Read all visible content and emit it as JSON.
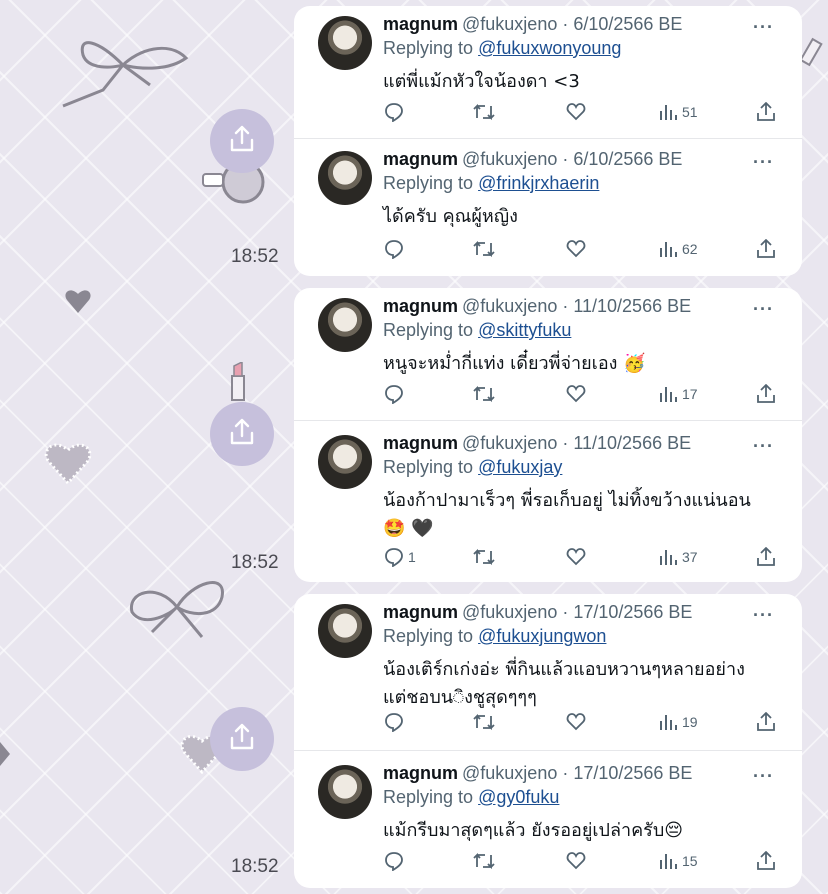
{
  "timestamps": [
    "18:52",
    "18:52",
    "18:52"
  ],
  "icons": {
    "share": "share-icon",
    "reply": "reply-icon",
    "retweet": "retweet-icon",
    "like": "heart-icon",
    "views": "views-icon",
    "more": "more-icon"
  },
  "colors": {
    "link": "#1d4f91",
    "muted": "#536471",
    "share_circle": "#c6c0dc"
  },
  "tweets": [
    {
      "name": "magnum",
      "handle": "@fukuxjeno · 6/10/2566 BE",
      "replying_prefix": "Replying to",
      "replying_to": "@fukuxwonyoung",
      "text": "แต่พี่แม้กหัวใจน้องดา <3",
      "replies": "",
      "views": "51",
      "more": "···"
    },
    {
      "name": "magnum",
      "handle": "@fukuxjeno · 6/10/2566 BE",
      "replying_prefix": "Replying to",
      "replying_to": "@frinkjrxhaerin",
      "text": "ได้ครับ คุณผู้หญิง",
      "replies": "",
      "views": "62",
      "more": "···"
    },
    {
      "name": "magnum",
      "handle": "@fukuxjeno · 11/10/2566 BE",
      "replying_prefix": "Replying to",
      "replying_to": "@skittyfuku",
      "text": "หนูจะหม่ำกี่แท่ง เดี๋ยวพี่จ่ายเอง 🥳",
      "replies": "",
      "views": "17",
      "more": "···"
    },
    {
      "name": "magnum",
      "handle": "@fukuxjeno · 11/10/2566 BE",
      "replying_prefix": "Replying to",
      "replying_to": "@fukuxjay",
      "text": "น้องก้าปามาเร็วๆ พี่รอเก็บอยู่ ไม่ทิ้งขว้างแน่นอน🤩 🖤",
      "replies": "1",
      "views": "37",
      "more": "···"
    },
    {
      "name": "magnum",
      "handle": "@fukuxjeno · 17/10/2566 BE",
      "replying_prefix": "Replying to",
      "replying_to": "@fukuxjungwon",
      "text": "น้องเติร์กเก่งอ่ะ พี่กินแล้วแอบหวานๆหลายอย่าง แต่ชอบน◌ิงชูสุดๆๆๆ",
      "replies": "",
      "views": "19",
      "more": "···"
    },
    {
      "name": "magnum",
      "handle": "@fukuxjeno · 17/10/2566 BE",
      "replying_prefix": "Replying to",
      "replying_to": "@gy0fuku",
      "text": "แม้กรีบมาสุดๆแล้ว ยังรออยู่เปล่าครับ😔",
      "replies": "",
      "views": "15",
      "more": "···"
    }
  ]
}
